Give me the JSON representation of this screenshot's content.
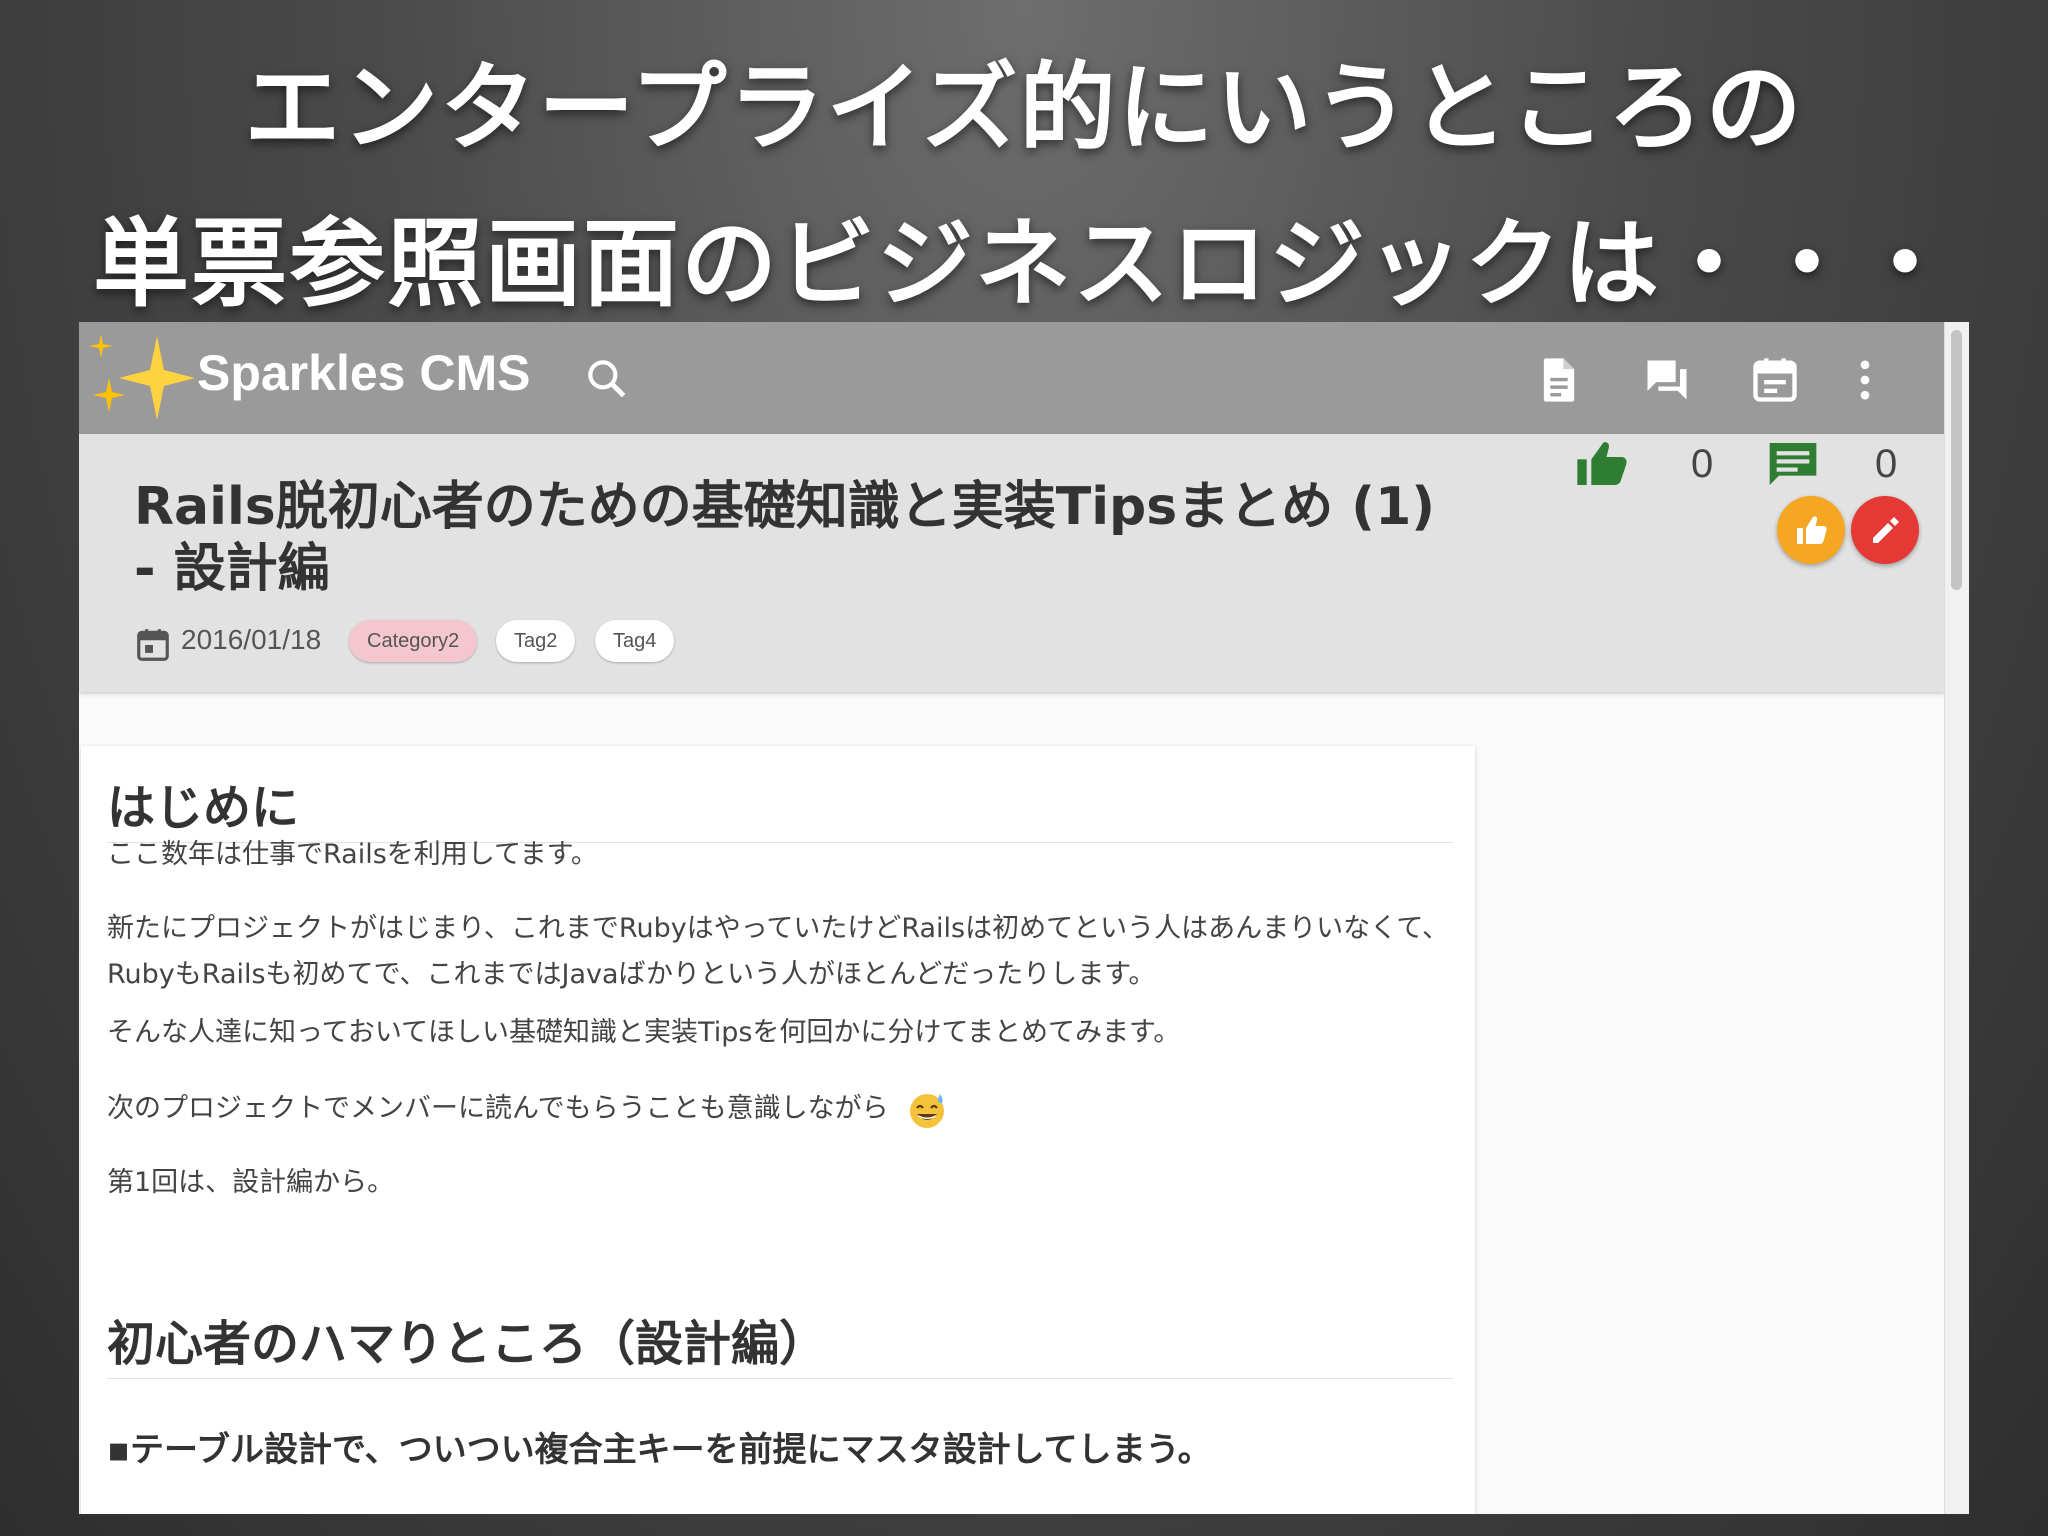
{
  "slide": {
    "title_line1": "エンタープライズ的にいうところの",
    "title_line2": "単票参照画面のビジネスロジックは・・・"
  },
  "app_bar": {
    "brand": "Sparkles CMS",
    "icons": [
      "sparkle-logo-icon",
      "search-icon",
      "document-icon",
      "forum-icon",
      "calendar-icon",
      "more-vert-icon"
    ]
  },
  "article": {
    "title": "Rails脱初心者のための基礎知識と実装Tipsまとめ (1) - 設計編",
    "date": "2016/01/18",
    "category": "Category2",
    "tags": [
      "Tag2",
      "Tag4"
    ],
    "likes_count": "0",
    "comments_count": "0"
  },
  "body": {
    "heading1": "はじめに",
    "paragraphs": [
      "ここ数年は仕事でRailsを利用してます。",
      "新たにプロジェクトがはじまり、これまでRubyはやっていたけどRailsは初めてという人はあんまりいなくて、RubyもRailsも初めてで、これまではJavaばかりという人がほとんどだったりします。",
      "そんな人達に知っておいてほしい基礎知識と実装Tipsを何回かに分けてまとめてみます。",
      "次のプロジェクトでメンバーに読んでもらうことも意識しながら",
      "第1回は、設計編から。"
    ],
    "heading2": "初心者のハマりところ（設計編）",
    "bullet": "▪テーブル設計で、ついつい複合主キーを前提にマスタ設計してしまう。"
  },
  "colors": {
    "app_bar": "#9a9a9a",
    "header_card": "#e2e2e2",
    "like_green": "#2e7d32",
    "fab_orange": "#f5a623",
    "fab_red": "#e53935",
    "category_chip": "#f4c7cf"
  }
}
